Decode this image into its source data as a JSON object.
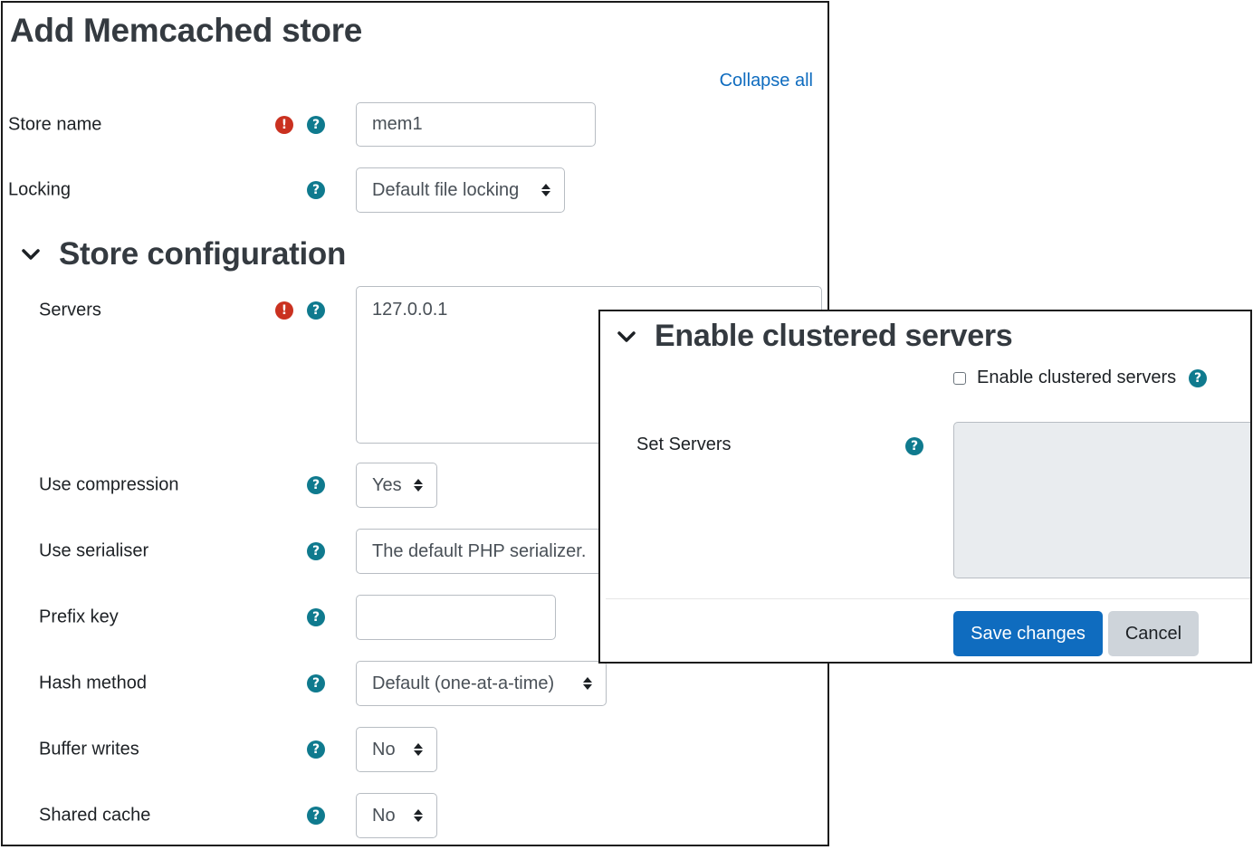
{
  "main": {
    "title": "Add Memcached store",
    "collapse_all": "Collapse all",
    "general_fields": [
      {
        "label": "Store name",
        "required": true,
        "type": "text",
        "value": "mem1"
      },
      {
        "label": "Locking",
        "required": false,
        "type": "select",
        "value": "Default file locking"
      }
    ],
    "section": {
      "title": "Store configuration",
      "expanded": true,
      "fields": [
        {
          "label": "Servers",
          "required": true,
          "type": "textarea",
          "value": "127.0.0.1"
        },
        {
          "label": "Use compression",
          "required": false,
          "type": "select",
          "value": "Yes"
        },
        {
          "label": "Use serialiser",
          "required": false,
          "type": "select",
          "value": "The default PHP serializer."
        },
        {
          "label": "Prefix key",
          "required": false,
          "type": "text",
          "value": ""
        },
        {
          "label": "Hash method",
          "required": false,
          "type": "select",
          "value": "Default (one-at-a-time)"
        },
        {
          "label": "Buffer writes",
          "required": false,
          "type": "select",
          "value": "No"
        },
        {
          "label": "Shared cache",
          "required": false,
          "type": "select",
          "value": "No"
        }
      ]
    }
  },
  "overlay": {
    "section_title": "Enable clustered servers",
    "expanded": true,
    "checkbox": {
      "label": "Enable clustered servers",
      "checked": false
    },
    "set_servers": {
      "label": "Set Servers",
      "value": "",
      "disabled": true
    },
    "buttons": {
      "save": "Save changes",
      "cancel": "Cancel"
    }
  },
  "icons": {
    "required": "exclamation-circle-icon",
    "help": "question-circle-icon",
    "section_toggle": "chevron-down-icon",
    "select_caret": "sort-caret-icon"
  },
  "colors": {
    "link": "#0f6cbf",
    "primary_button": "#0f6cbf",
    "secondary_button": "#ced4da",
    "required_icon": "#ca3120",
    "help_icon": "#0f7a8e",
    "heading": "#343a40",
    "disabled_field": "#e9ecef"
  }
}
